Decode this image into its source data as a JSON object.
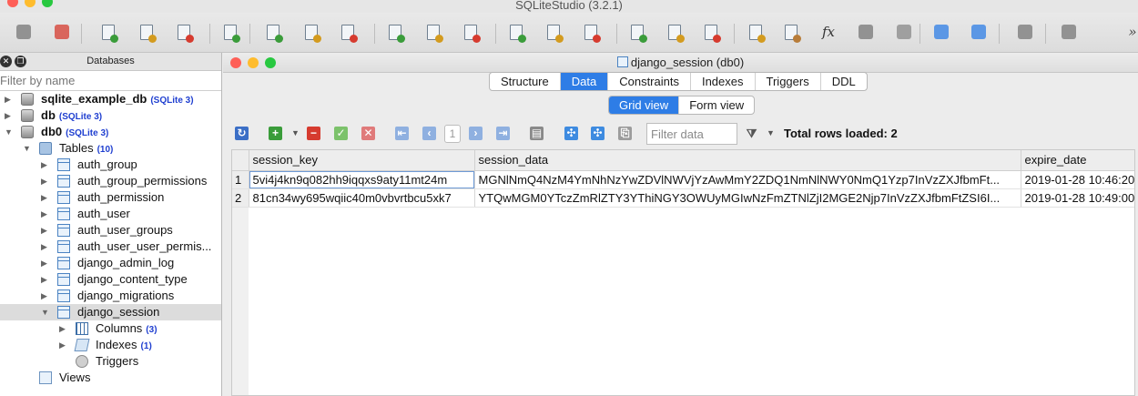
{
  "app": {
    "title": "SQLiteStudio (3.2.1)"
  },
  "toolbar": {
    "buttons": [
      {
        "name": "connect-db",
        "icon": "plug-icon",
        "color": "#777777"
      },
      {
        "name": "disconnect-db",
        "icon": "plug-off-icon",
        "color": "#d63b2f"
      },
      {
        "name": "add-db",
        "icon": "db-add-icon",
        "color": "#3a9c3a"
      },
      {
        "name": "edit-db",
        "icon": "db-edit-icon",
        "color": "#d39b1f"
      },
      {
        "name": "delete-db",
        "icon": "db-delete-icon",
        "color": "#d63b2f"
      },
      {
        "name": "refresh-db",
        "icon": "db-refresh-icon",
        "color": "#3a9c3a"
      },
      {
        "name": "create-table",
        "icon": "table-add-icon",
        "color": "#3a9c3a"
      },
      {
        "name": "edit-table",
        "icon": "table-edit-icon",
        "color": "#d39b1f"
      },
      {
        "name": "delete-table",
        "icon": "table-delete-icon",
        "color": "#d63b2f"
      },
      {
        "name": "create-index",
        "icon": "index-add-icon",
        "color": "#3a9c3a"
      },
      {
        "name": "edit-index",
        "icon": "index-edit-icon",
        "color": "#d39b1f"
      },
      {
        "name": "delete-index",
        "icon": "index-delete-icon",
        "color": "#d63b2f"
      },
      {
        "name": "create-trigger",
        "icon": "trigger-add-icon",
        "color": "#3a9c3a"
      },
      {
        "name": "edit-trigger",
        "icon": "trigger-edit-icon",
        "color": "#d39b1f"
      },
      {
        "name": "delete-trigger",
        "icon": "trigger-delete-icon",
        "color": "#d63b2f"
      },
      {
        "name": "create-view",
        "icon": "view-add-icon",
        "color": "#3a9c3a"
      },
      {
        "name": "edit-view",
        "icon": "view-edit-icon",
        "color": "#d39b1f"
      },
      {
        "name": "delete-view",
        "icon": "view-delete-icon",
        "color": "#d63b2f"
      },
      {
        "name": "sql-editor",
        "icon": "sql-editor-icon",
        "color": "#d39b1f"
      },
      {
        "name": "import",
        "icon": "import-icon",
        "color": "#b87d3a"
      },
      {
        "name": "functions",
        "icon": "fx-icon",
        "color": "#333333",
        "text": "fx"
      },
      {
        "name": "collations",
        "icon": "collation-icon",
        "color": "#777777"
      },
      {
        "name": "extensions",
        "icon": "extension-icon",
        "color": "#888888"
      },
      {
        "name": "tile-windows",
        "icon": "tile-icon",
        "color": "#2e7de6"
      },
      {
        "name": "cascade-windows",
        "icon": "cascade-icon",
        "color": "#2e7de6"
      },
      {
        "name": "preferences",
        "icon": "wrench-icon",
        "color": "#777777"
      },
      {
        "name": "layout",
        "icon": "grid-layout-icon",
        "color": "#777777"
      },
      {
        "name": "more",
        "icon": "chevron-right-icon",
        "color": "#444444",
        "text": "»"
      }
    ]
  },
  "databases_panel": {
    "title": "Databases",
    "filter_placeholder": "Filter by name",
    "tree": [
      {
        "label": "sqlite_example_db",
        "badge": "(SQLite 3)",
        "type": "db",
        "level": 0,
        "arrow": "▶",
        "bold": true
      },
      {
        "label": "db",
        "badge": "(SQLite 3)",
        "type": "db",
        "level": 0,
        "arrow": "▶",
        "bold": true
      },
      {
        "label": "db0",
        "badge": "(SQLite 3)",
        "type": "db",
        "level": 0,
        "arrow": "▼",
        "bold": true
      },
      {
        "label": "Tables",
        "badge": "(10)",
        "type": "folder",
        "level": 1,
        "arrow": "▼"
      },
      {
        "label": "auth_group",
        "type": "tbl",
        "level": 2,
        "arrow": "▶"
      },
      {
        "label": "auth_group_permissions",
        "type": "tbl",
        "level": 2,
        "arrow": "▶"
      },
      {
        "label": "auth_permission",
        "type": "tbl",
        "level": 2,
        "arrow": "▶"
      },
      {
        "label": "auth_user",
        "type": "tbl",
        "level": 2,
        "arrow": "▶"
      },
      {
        "label": "auth_user_groups",
        "type": "tbl",
        "level": 2,
        "arrow": "▶"
      },
      {
        "label": "auth_user_user_permis...",
        "type": "tbl",
        "level": 2,
        "arrow": "▶"
      },
      {
        "label": "django_admin_log",
        "type": "tbl",
        "level": 2,
        "arrow": "▶"
      },
      {
        "label": "django_content_type",
        "type": "tbl",
        "level": 2,
        "arrow": "▶"
      },
      {
        "label": "django_migrations",
        "type": "tbl",
        "level": 2,
        "arrow": "▶"
      },
      {
        "label": "django_session",
        "type": "tbl",
        "level": 2,
        "arrow": "▼",
        "selected": true
      },
      {
        "label": "Columns",
        "badge": "(3)",
        "type": "cols",
        "level": 3,
        "arrow": "▶"
      },
      {
        "label": "Indexes",
        "badge": "(1)",
        "type": "idx",
        "level": 3,
        "arrow": "▶"
      },
      {
        "label": "Triggers",
        "type": "trg",
        "level": 3,
        "arrow": ""
      },
      {
        "label": "Views",
        "type": "views",
        "level": 1,
        "arrow": ""
      }
    ]
  },
  "document": {
    "title": "django_session (db0)",
    "tabs": [
      "Structure",
      "Data",
      "Constraints",
      "Indexes",
      "Triggers",
      "DDL"
    ],
    "active_tab": "Data",
    "view_tabs": [
      "Grid view",
      "Form view"
    ],
    "active_view": "Grid view",
    "page_number": "1",
    "filter_placeholder": "Filter data",
    "rows_loaded": "Total rows loaded: 2",
    "grid": {
      "columns": [
        "session_key",
        "session_data",
        "expire_date"
      ],
      "rows": [
        [
          "1",
          "5vi4j4kn9q082hh9iqqxs9aty11mt24m",
          "MGNlNmQ4NzM4YmNhNzYwZDVlNWVjYzAwMmY2ZDQ1NmNlNWY0NmQ1Yzp7InVzZXJfbmFt...",
          "2019-01-28 10:46:20"
        ],
        [
          "2",
          "81cn34wy695wqiic40m0vbvrtbcu5xk7",
          "YTQwMGM0YTczZmRlZTY3YThiNGY3OWUyMGIwNzFmZTNlZjI2MGE2Njp7InVzZXJfbmFtZSI6I...",
          "2019-01-28 10:49:00"
        ]
      ]
    }
  },
  "colors": {
    "accent": "#2e7de6",
    "close": "#fe5f57",
    "minimize": "#febc2e",
    "zoom": "#28c840",
    "badge": "#1f3fd0"
  }
}
